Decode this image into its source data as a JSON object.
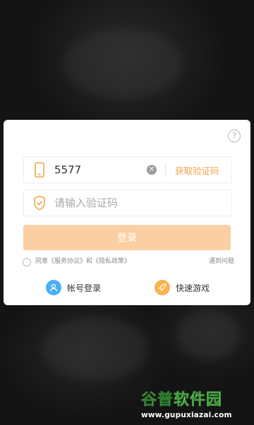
{
  "login": {
    "phone_value": "5577",
    "get_code_label": "获取验证码",
    "code_placeholder": "请输入验证码",
    "login_button": "登录",
    "agree_prefix": "同意",
    "terms_link": "《服务协议》",
    "agree_and": "和",
    "privacy_link": "《隐私政策》",
    "trouble_link": "遇到问题",
    "account_login": "帐号登录",
    "quick_game": "快速游戏"
  },
  "watermark": {
    "site_name_part1": "谷普",
    "site_name_part2": "软件园",
    "url": "www.gupuxiazai.com"
  },
  "colors": {
    "accent": "#f4a24a",
    "button_disabled": "#f9cfa3",
    "account_icon": "#4ab0f3",
    "quick_icon": "#f7b34e"
  },
  "icons": [
    "help-icon",
    "phone-icon",
    "shield-check-icon",
    "clear-icon",
    "user-icon",
    "rocket-icon"
  ]
}
